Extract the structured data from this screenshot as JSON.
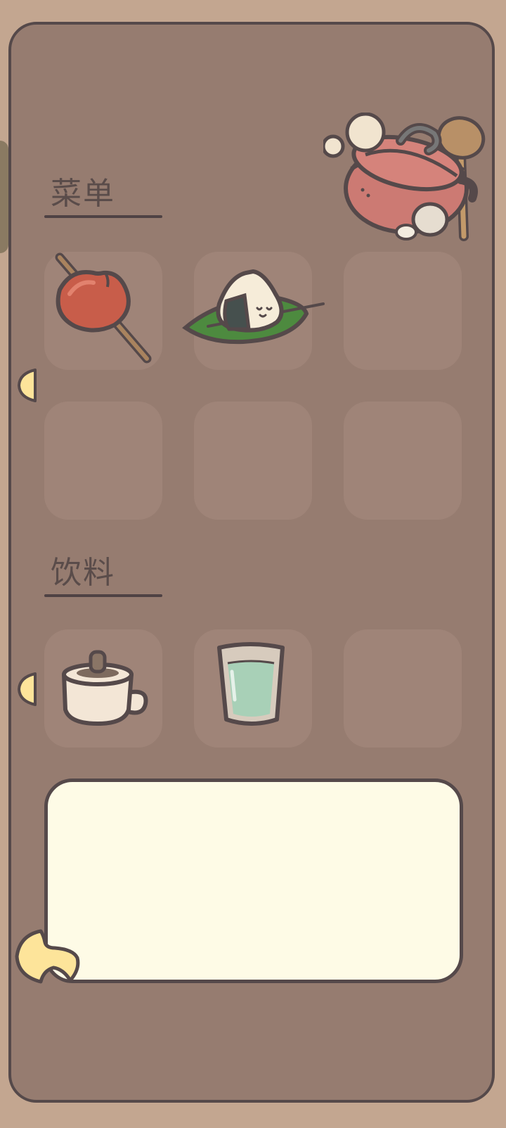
{
  "colors": {
    "background": "#c3a690",
    "panel": "#967c70",
    "slot": "#9f8478",
    "border": "#55494a",
    "dialog": "#fefbe6",
    "arrow": "#fde49a"
  },
  "menu": {
    "title": "菜单",
    "items": [
      {
        "icon": "candied-apple-icon",
        "filled": true
      },
      {
        "icon": "rice-ball-on-leaf-icon",
        "filled": true
      },
      {
        "icon": "",
        "filled": false
      },
      {
        "icon": "",
        "filled": false
      },
      {
        "icon": "",
        "filled": false
      },
      {
        "icon": "",
        "filled": false
      }
    ]
  },
  "drinks": {
    "title": "饮料",
    "items": [
      {
        "icon": "coffee-cup-icon",
        "filled": true
      },
      {
        "icon": "water-glass-icon",
        "filled": true
      },
      {
        "icon": "",
        "filled": false
      }
    ]
  },
  "decoration": {
    "icon": "cooking-pot-icon"
  },
  "dialog": {
    "text": ""
  }
}
